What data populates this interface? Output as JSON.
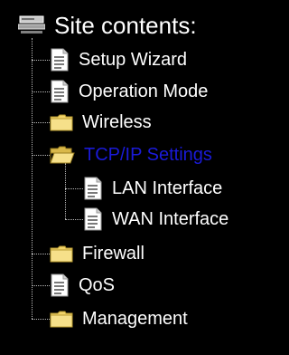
{
  "tree": {
    "root": {
      "label": "Site contents:",
      "icon": "computer-icon"
    },
    "items": [
      {
        "label": "Setup Wizard",
        "icon": "page-icon",
        "active": false
      },
      {
        "label": "Operation Mode",
        "icon": "page-icon",
        "active": false
      },
      {
        "label": "Wireless",
        "icon": "folder-closed-icon",
        "active": false
      },
      {
        "label": "TCP/IP Settings",
        "icon": "folder-open-icon",
        "active": true,
        "children": [
          {
            "label": "LAN Interface",
            "icon": "page-icon"
          },
          {
            "label": "WAN Interface",
            "icon": "page-icon"
          }
        ]
      },
      {
        "label": "Firewall",
        "icon": "folder-closed-icon",
        "active": false
      },
      {
        "label": "QoS",
        "icon": "page-icon",
        "active": false
      },
      {
        "label": "Management",
        "icon": "folder-closed-icon",
        "active": false
      }
    ]
  },
  "colors": {
    "background": "#000000",
    "text": "#ffffff",
    "active_text": "#1a1ad8",
    "folder": "#f2d46a",
    "page": "#e8e8e8"
  }
}
